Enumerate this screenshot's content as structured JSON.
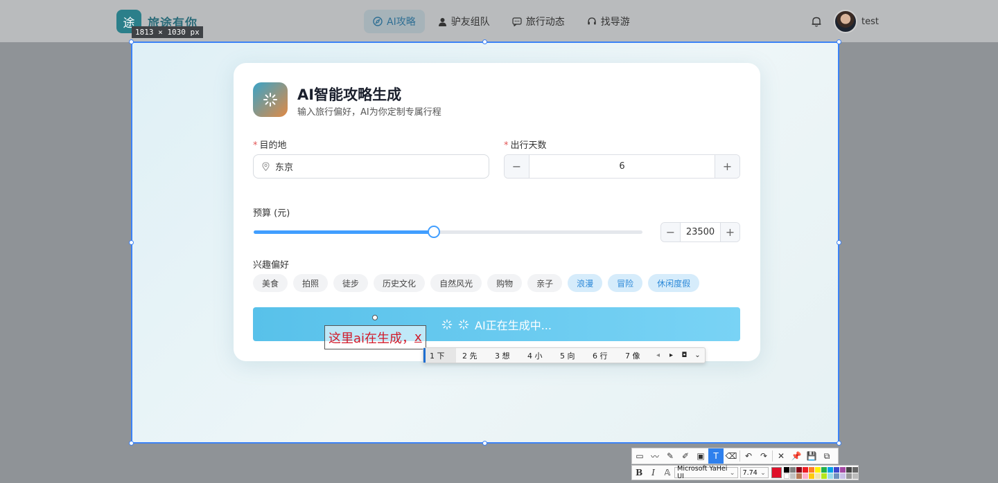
{
  "topnav": {
    "logo_char": "途",
    "brand": "旅途有你",
    "tabs": [
      "AI攻略",
      "驴友组队",
      "旅行动态",
      "找导游"
    ],
    "username": "test"
  },
  "size_badge": "1813 × 1030  px",
  "card": {
    "title": "AI智能攻略生成",
    "subtitle": "输入旅行偏好，AI为你定制专属行程",
    "destination": {
      "label": "目的地",
      "value": "东京"
    },
    "days": {
      "label": "出行天数",
      "value": "6",
      "minus": "−",
      "plus": "+"
    },
    "budget": {
      "label": "预算 (元)",
      "value": "23500",
      "fill_fraction": 0.463
    },
    "interests": {
      "label": "兴趣偏好",
      "tags": [
        {
          "text": "美食",
          "selected": false
        },
        {
          "text": "拍照",
          "selected": false
        },
        {
          "text": "徒步",
          "selected": false
        },
        {
          "text": "历史文化",
          "selected": false
        },
        {
          "text": "自然风光",
          "selected": false
        },
        {
          "text": "购物",
          "selected": false
        },
        {
          "text": "亲子",
          "selected": false
        },
        {
          "text": "浪漫",
          "selected": true
        },
        {
          "text": "冒险",
          "selected": true
        },
        {
          "text": "休闲度假",
          "selected": true
        }
      ]
    },
    "generate_button": "AI正在生成中..."
  },
  "annotation": {
    "text": "这里ai在生成，",
    "composing": "x"
  },
  "ime": {
    "candidates": [
      "1 下",
      "2 先",
      "3 想",
      "4 小",
      "5 向",
      "6 行",
      "7 像"
    ]
  },
  "toolbar": {
    "font_name": "Microsoft YaHei UI",
    "font_size": "7.74",
    "bold": "B",
    "italic": "I",
    "current_color": "#e0102a"
  },
  "colors": {
    "accent": "#409eff",
    "tag_selected_bg": "#d6ecfb",
    "button": "#5ec3ec",
    "annotation_text": "#d11a2a"
  }
}
